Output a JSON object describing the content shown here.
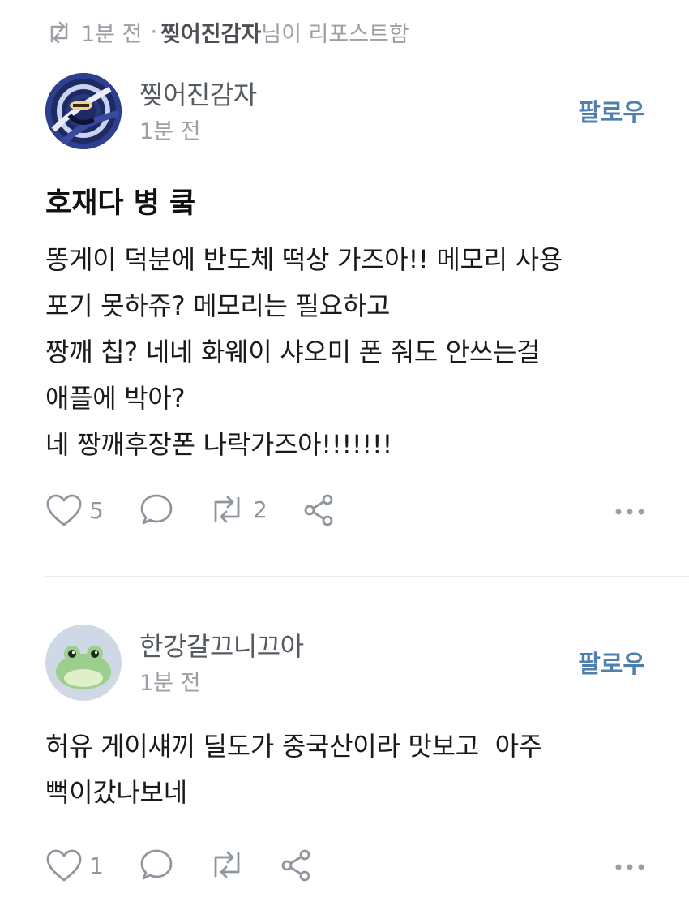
{
  "banner": {
    "time": "1분 전",
    "separator": "·",
    "reposter": "찢어진감자",
    "suffix": "님이 리포스트함"
  },
  "posts": [
    {
      "author": "찢어진감자",
      "time": "1분 전",
      "follow_label": "팔로우",
      "title": "호재다 병 쿸",
      "body": [
        "똥게이 덕분에 반도체 떡상 가즈아!! 메모리 사용",
        "포기 못하쥬? 메모리는 필요하고",
        "짱깨 칩? 네네 화웨이 샤오미 폰 줘도 안쓰는걸",
        "애플에 박아?",
        "네 짱깨후장폰 나락가즈아!!!!!!!"
      ],
      "likes": "5",
      "reposts": "2"
    },
    {
      "author": "한강갈끄니끄아",
      "time": "1분 전",
      "follow_label": "팔로우",
      "body": [
        "허유 게이섀끼 딜도가 중국산이라 맛보고  아주",
        "뻑이갔나보네"
      ],
      "likes": "1"
    }
  ],
  "colors": {
    "accent": "#4f7fae",
    "muted": "#9aa0a6",
    "icon": "#8e959c"
  }
}
